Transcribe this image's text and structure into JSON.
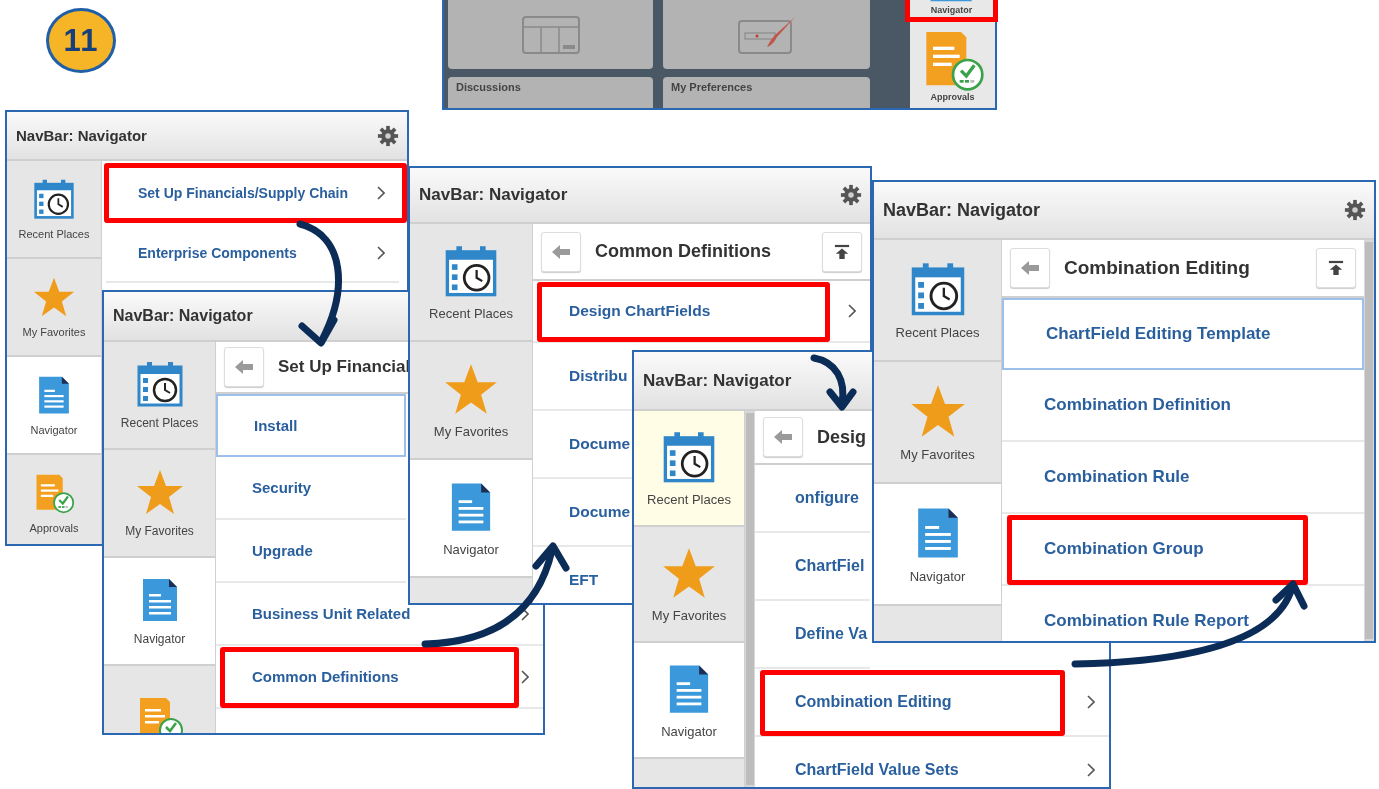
{
  "step_badge": "11",
  "home_panel": {
    "tiles": [
      {
        "kind": "icon"
      },
      {
        "kind": "icon"
      },
      {
        "kind": "label",
        "label": "Discussions"
      },
      {
        "kind": "label",
        "label": "My Preferences"
      }
    ],
    "nav_items": [
      {
        "kind": "navigator",
        "label": "Navigator",
        "selected": false,
        "highlighted": true
      },
      {
        "kind": "approvals",
        "label": "Approvals",
        "selected": false,
        "highlighted": false
      }
    ]
  },
  "navigator_panels": [
    {
      "title": "NavBar: Navigator",
      "settings_icon": true,
      "scrollbar_left": false,
      "scrollbar_right": false,
      "sidebar": [
        {
          "kind": "recent",
          "label": "Recent Places",
          "selected": false,
          "hovered": false
        },
        {
          "kind": "favorites",
          "label": "My Favorites",
          "selected": false,
          "hovered": false
        },
        {
          "kind": "navigator",
          "label": "Navigator",
          "selected": true,
          "hovered": false
        },
        {
          "kind": "approvals",
          "label": "Approvals",
          "selected": false,
          "hovered": false
        }
      ],
      "rows": [
        {
          "label": "Set Up Financials/Supply Chain",
          "chevron": true,
          "highlighted": true,
          "focused": false
        },
        {
          "label": "Enterprise Components",
          "chevron": true,
          "highlighted": false,
          "focused": false
        }
      ]
    },
    {
      "title": "NavBar: Navigator",
      "settings_icon": false,
      "scrollbar_left": false,
      "scrollbar_right": false,
      "sidebar": [
        {
          "kind": "recent",
          "label": "Recent Places",
          "selected": false,
          "hovered": false
        },
        {
          "kind": "favorites",
          "label": "My Favorites",
          "selected": false,
          "hovered": false
        },
        {
          "kind": "navigator",
          "label": "Navigator",
          "selected": true,
          "hovered": false
        },
        {
          "kind": "approvals",
          "selected": false,
          "hovered": false
        }
      ],
      "header": {
        "title": "Set Up Financial",
        "top_button": false
      },
      "rows": [
        {
          "label": "Install",
          "chevron": false,
          "highlighted": false,
          "focused": true
        },
        {
          "label": "Security",
          "chevron": false,
          "highlighted": false,
          "focused": false
        },
        {
          "label": "Upgrade",
          "chevron": false,
          "highlighted": false,
          "focused": false
        },
        {
          "label": "Business Unit Related",
          "chevron": true,
          "highlighted": false,
          "focused": false
        },
        {
          "label": "Common Definitions",
          "chevron": true,
          "highlighted": true,
          "focused": false
        }
      ]
    },
    {
      "title": "NavBar: Navigator",
      "settings_icon": true,
      "scrollbar_left": false,
      "scrollbar_right": false,
      "sidebar": [
        {
          "kind": "recent",
          "label": "Recent Places",
          "selected": false,
          "hovered": false
        },
        {
          "kind": "favorites",
          "label": "My Favorites",
          "selected": false,
          "hovered": false
        },
        {
          "kind": "navigator",
          "label": "Navigator",
          "selected": true,
          "hovered": false
        }
      ],
      "header": {
        "title": "Common Definitions",
        "top_button": true
      },
      "rows": [
        {
          "label": "Design ChartFields",
          "chevron": true,
          "highlighted": true,
          "focused": false
        },
        {
          "label": "Distribu",
          "chevron": false,
          "highlighted": false,
          "focused": false
        },
        {
          "label": "Docume",
          "chevron": false,
          "highlighted": false,
          "focused": false
        },
        {
          "label": "Docume",
          "chevron": false,
          "highlighted": false,
          "focused": false
        },
        {
          "label": "EFT",
          "chevron": false,
          "highlighted": false,
          "focused": false
        }
      ]
    },
    {
      "title": "NavBar: Navigator",
      "settings_icon": false,
      "scrollbar_left": true,
      "scrollbar_right": false,
      "sidebar": [
        {
          "kind": "recent",
          "label": "Recent Places",
          "selected": false,
          "hovered": true
        },
        {
          "kind": "favorites",
          "label": "My Favorites",
          "selected": false,
          "hovered": false
        },
        {
          "kind": "navigator",
          "label": "Navigator",
          "selected": true,
          "hovered": false
        }
      ],
      "header": {
        "title": "Desig",
        "top_button": false
      },
      "rows": [
        {
          "label": "onfigure",
          "chevron": false,
          "highlighted": false,
          "focused": false
        },
        {
          "label": "ChartFiel",
          "chevron": false,
          "highlighted": false,
          "focused": false
        },
        {
          "label": "Define Va",
          "chevron": false,
          "highlighted": false,
          "focused": false
        },
        {
          "label": "Combination Editing",
          "chevron": true,
          "highlighted": true,
          "focused": false
        },
        {
          "label": "ChartField Value Sets",
          "chevron": true,
          "highlighted": false,
          "focused": false
        }
      ]
    },
    {
      "title": "NavBar: Navigator",
      "settings_icon": true,
      "scrollbar_left": false,
      "scrollbar_right": true,
      "sidebar": [
        {
          "kind": "recent",
          "label": "Recent Places",
          "selected": false,
          "hovered": false
        },
        {
          "kind": "favorites",
          "label": "My Favorites",
          "selected": false,
          "hovered": false
        },
        {
          "kind": "navigator",
          "label": "Navigator",
          "selected": true,
          "hovered": false
        }
      ],
      "header": {
        "title": "Combination Editing",
        "top_button": true
      },
      "rows": [
        {
          "label": "ChartField Editing Template",
          "chevron": false,
          "highlighted": false,
          "focused": true
        },
        {
          "label": "Combination Definition",
          "chevron": false,
          "highlighted": false,
          "focused": false
        },
        {
          "label": "Combination Rule",
          "chevron": false,
          "highlighted": false,
          "focused": false
        },
        {
          "label": "Combination Group",
          "chevron": false,
          "highlighted": true,
          "focused": false
        },
        {
          "label": "Combination Rule Report",
          "chevron": false,
          "highlighted": false,
          "focused": false
        }
      ]
    }
  ]
}
